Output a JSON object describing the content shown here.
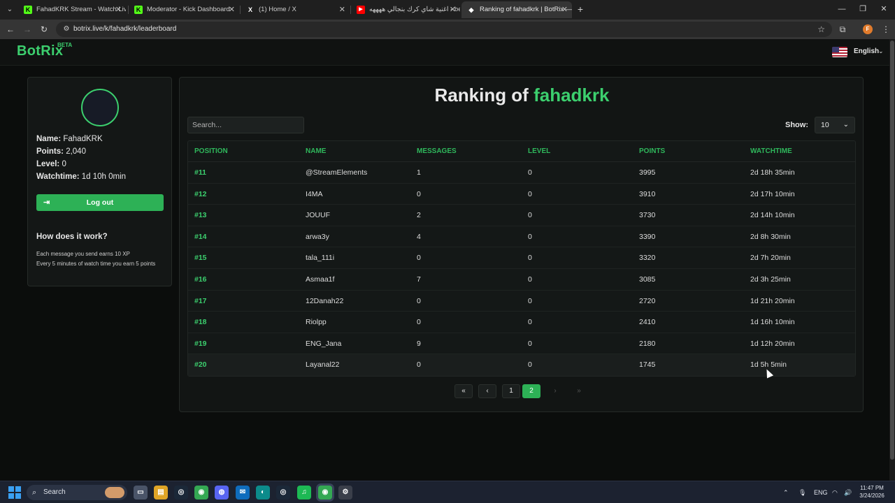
{
  "browser": {
    "tabs": [
      {
        "title": "FahadKRK Stream - Watch Live",
        "icon": "kick-icon",
        "icon_glyph": "K",
        "icon_color": "#53fc18"
      },
      {
        "title": "Moderator - Kick Dashboard",
        "icon": "kick-icon",
        "icon_glyph": "K",
        "icon_color": "#53fc18"
      },
      {
        "title": "(1) Home / X",
        "icon": "x-icon",
        "icon_glyph": "X",
        "icon_color": "#ffffff"
      },
      {
        "title": "اغنية شاي كرك بنجالي ههههه - be",
        "icon": "youtube-icon",
        "icon_glyph": "▶",
        "icon_color": "#ff0000"
      },
      {
        "title": "Ranking of fahadkrk | BotRix —",
        "icon": "botrix-icon",
        "icon_glyph": "◆",
        "icon_color": "#ffffff"
      }
    ],
    "new_tab_glyph": "+",
    "url": "botrix.live/k/fahadkrk/leaderboard",
    "window_controls": {
      "minimize": "—",
      "maximize": "❐",
      "close": "✕"
    },
    "profile_initial": "F"
  },
  "site": {
    "logo": "BotRix",
    "beta": "BETA",
    "language": "English",
    "language_caret": "⌄"
  },
  "profile": {
    "name_label": "Name:",
    "name_value": "FahadKRK",
    "points_label": "Points:",
    "points_value": "2,040",
    "level_label": "Level:",
    "level_value": "0",
    "watchtime_label": "Watchtime:",
    "watchtime_value": "1d 10h 0min",
    "logout_label": "Log out",
    "how_title": "How does it work?",
    "how_line1": "Each message you send earns 10 XP",
    "how_line2": "Every 5 minutes of watch time you earn 5 points"
  },
  "leaderboard": {
    "title_prefix": "Ranking of",
    "streamer": "fahadkrk",
    "search_placeholder": "Search...",
    "show_label": "Show:",
    "show_value": "10",
    "columns": [
      "POSITION",
      "NAME",
      "MESSAGES",
      "LEVEL",
      "POINTS",
      "WATCHTIME"
    ],
    "rows": [
      [
        "#11",
        "@StreamElements",
        "1",
        "0",
        "3995",
        "2d 18h 35min"
      ],
      [
        "#12",
        "I4MA",
        "0",
        "0",
        "3910",
        "2d 17h 10min"
      ],
      [
        "#13",
        "JOUUF",
        "2",
        "0",
        "3730",
        "2d 14h 10min"
      ],
      [
        "#14",
        "arwa3y",
        "4",
        "0",
        "3390",
        "2d 8h 30min"
      ],
      [
        "#15",
        "tala_111i",
        "0",
        "0",
        "3320",
        "2d 7h 20min"
      ],
      [
        "#16",
        "Asmaa1f",
        "7",
        "0",
        "3085",
        "2d 3h 25min"
      ],
      [
        "#17",
        "12Danah22",
        "0",
        "0",
        "2720",
        "1d 21h 20min"
      ],
      [
        "#18",
        "Riolpp",
        "0",
        "0",
        "2410",
        "1d 16h 10min"
      ],
      [
        "#19",
        "ENG_Jana",
        "9",
        "0",
        "2180",
        "1d 12h 20min"
      ],
      [
        "#20",
        "Layanal22",
        "0",
        "0",
        "1745",
        "1d 5h 5min"
      ]
    ],
    "pagination": {
      "first": "«",
      "prev": "‹",
      "pages": [
        "1",
        "2"
      ],
      "current_page": "2",
      "next": "›",
      "last": "»"
    }
  },
  "taskbar": {
    "search_label": "Search",
    "language": "ENG",
    "time": "11:47 PM",
    "date": "3/24/2026"
  }
}
